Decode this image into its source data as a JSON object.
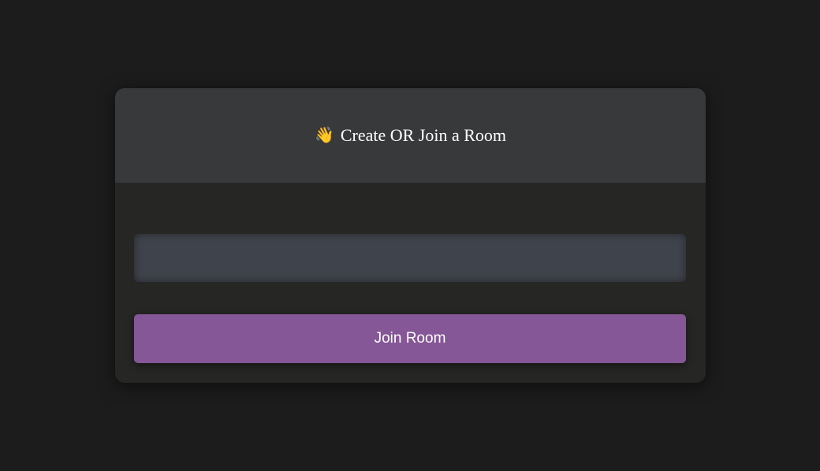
{
  "card": {
    "header": {
      "icon": "waving-hand-icon",
      "icon_glyph": "👋",
      "title": "Create OR Join a Room"
    },
    "room_input": {
      "value": "",
      "placeholder": ""
    },
    "join_button": {
      "label": "Join Room"
    }
  },
  "colors": {
    "page_background": "#1c1c1c",
    "card_body": "#262624",
    "card_header": "#38393b",
    "input_background": "#3f434b",
    "button_accent": "#855796"
  }
}
